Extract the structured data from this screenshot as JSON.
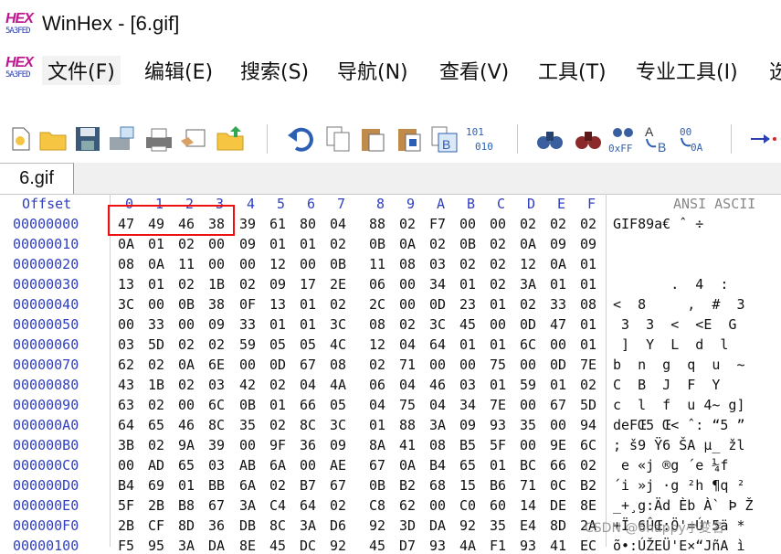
{
  "window": {
    "title": "WinHex - [6.gif]",
    "logo_text": "HEX",
    "logo_sub": "5A3FED"
  },
  "menu": [
    "文件(F)",
    "编辑(E)",
    "搜索(S)",
    "导航(N)",
    "查看(V)",
    "工具(T)",
    "专业工具(I)",
    "选"
  ],
  "toolbar_icons": [
    "new-file-icon",
    "open-folder-icon",
    "save-disk-icon",
    "save-all-icon",
    "print-icon",
    "properties-icon",
    "open-folder-up-icon",
    "undo-icon",
    "copy-icon",
    "paste-icon",
    "paste-write-icon",
    "copy-hex-icon",
    "convert-icon",
    "binoculars-icon",
    "find-text-icon",
    "find-hex-icon",
    "replace-text-icon",
    "replace-hex-icon",
    "goto-offset-icon"
  ],
  "toolbar_labels": {
    "hex_find": "0xFF",
    "convert_a": "101",
    "convert_b": "010",
    "rep_ab": "A",
    "rep_b": "B",
    "rep_hex_top": "00",
    "rep_hex_bot": "0A"
  },
  "tab": {
    "label": "6.gif"
  },
  "hex": {
    "offset_header": "Offset",
    "column_headers": [
      "0",
      "1",
      "2",
      "3",
      "4",
      "5",
      "6",
      "7",
      "8",
      "9",
      "A",
      "B",
      "C",
      "D",
      "E",
      "F"
    ],
    "ansi_header": "ANSI ASCII",
    "rows": [
      {
        "offset": "00000000",
        "bytes": [
          "47",
          "49",
          "46",
          "38",
          "39",
          "61",
          "80",
          "04",
          "88",
          "02",
          "F7",
          "00",
          "00",
          "02",
          "02",
          "02"
        ],
        "ansi": "GIF89a€ ˆ ÷"
      },
      {
        "offset": "00000010",
        "bytes": [
          "0A",
          "01",
          "02",
          "00",
          "09",
          "01",
          "01",
          "02",
          "0B",
          "0A",
          "02",
          "0B",
          "02",
          "0A",
          "09",
          "09"
        ],
        "ansi": ""
      },
      {
        "offset": "00000020",
        "bytes": [
          "08",
          "0A",
          "11",
          "00",
          "00",
          "12",
          "00",
          "0B",
          "11",
          "08",
          "03",
          "02",
          "02",
          "12",
          "0A",
          "01"
        ],
        "ansi": ""
      },
      {
        "offset": "00000030",
        "bytes": [
          "13",
          "01",
          "02",
          "1B",
          "02",
          "09",
          "17",
          "2E",
          "06",
          "00",
          "34",
          "01",
          "02",
          "3A",
          "01",
          "01"
        ],
        "ansi": "       .  4  :"
      },
      {
        "offset": "00000040",
        "bytes": [
          "3C",
          "00",
          "0B",
          "38",
          "0F",
          "13",
          "01",
          "02",
          "2C",
          "00",
          "0D",
          "23",
          "01",
          "02",
          "33",
          "08"
        ],
        "ansi": "<  8     ,  #  3"
      },
      {
        "offset": "00000050",
        "bytes": [
          "00",
          "33",
          "00",
          "09",
          "33",
          "01",
          "01",
          "3C",
          "08",
          "02",
          "3C",
          "45",
          "00",
          "0D",
          "47",
          "01"
        ],
        "ansi": " 3  3  <  <E  G"
      },
      {
        "offset": "00000060",
        "bytes": [
          "03",
          "5D",
          "02",
          "02",
          "59",
          "05",
          "05",
          "4C",
          "12",
          "04",
          "64",
          "01",
          "01",
          "6C",
          "00",
          "01"
        ],
        "ansi": " ]  Y  L  d  l"
      },
      {
        "offset": "00000070",
        "bytes": [
          "62",
          "02",
          "0A",
          "6E",
          "00",
          "0D",
          "67",
          "08",
          "02",
          "71",
          "00",
          "00",
          "75",
          "00",
          "0D",
          "7E"
        ],
        "ansi": "b  n  g  q  u  ~"
      },
      {
        "offset": "00000080",
        "bytes": [
          "43",
          "1B",
          "02",
          "03",
          "42",
          "02",
          "04",
          "4A",
          "06",
          "04",
          "46",
          "03",
          "01",
          "59",
          "01",
          "02"
        ],
        "ansi": "C  B  J  F  Y"
      },
      {
        "offset": "00000090",
        "bytes": [
          "63",
          "02",
          "00",
          "6C",
          "0B",
          "01",
          "66",
          "05",
          "04",
          "75",
          "04",
          "34",
          "7E",
          "00",
          "67",
          "5D"
        ],
        "ansi": "c  l  f  u 4~ g]"
      },
      {
        "offset": "000000A0",
        "bytes": [
          "64",
          "65",
          "46",
          "8C",
          "35",
          "02",
          "8C",
          "3C",
          "01",
          "88",
          "3A",
          "09",
          "93",
          "35",
          "00",
          "94"
        ],
        "ansi": "deFŒ5 Œ< ˆ: “5 ”"
      },
      {
        "offset": "000000B0",
        "bytes": [
          "3B",
          "02",
          "9A",
          "39",
          "00",
          "9F",
          "36",
          "09",
          "8A",
          "41",
          "08",
          "B5",
          "5F",
          "00",
          "9E",
          "6C"
        ],
        "ansi": "; š9 Ÿ6 ŠA µ_ žl"
      },
      {
        "offset": "000000C0",
        "bytes": [
          "00",
          "AD",
          "65",
          "03",
          "AB",
          "6A",
          "00",
          "AE",
          "67",
          "0A",
          "B4",
          "65",
          "01",
          "BC",
          "66",
          "02"
        ],
        "ansi": " ­e «j ®g ´e ¼f"
      },
      {
        "offset": "000000D0",
        "bytes": [
          "B4",
          "69",
          "01",
          "BB",
          "6A",
          "02",
          "B7",
          "67",
          "0B",
          "B2",
          "68",
          "15",
          "B6",
          "71",
          "0C",
          "B2"
        ],
        "ansi": "´i »j ·g ²h ¶q ²"
      },
      {
        "offset": "000000E0",
        "bytes": [
          "5F",
          "2B",
          "B8",
          "67",
          "3A",
          "C4",
          "64",
          "02",
          "C8",
          "62",
          "00",
          "C0",
          "60",
          "14",
          "DE",
          "8E"
        ],
        "ansi": "_+¸g:Äd Èb À` Þ Ž"
      },
      {
        "offset": "000000F0",
        "bytes": [
          "2B",
          "CF",
          "8D",
          "36",
          "DB",
          "8C",
          "3A",
          "D6",
          "92",
          "3D",
          "DA",
          "92",
          "35",
          "E4",
          "8D",
          "2A"
        ],
        "ansi": "+Ï 6ÛŒ:Ö'=Ú'5ä *"
      },
      {
        "offset": "00000100",
        "bytes": [
          "F5",
          "95",
          "3A",
          "DA",
          "8E",
          "45",
          "DC",
          "92",
          "45",
          "D7",
          "93",
          "4A",
          "F1",
          "93",
          "41",
          "EC"
        ],
        "ansi": "õ•:ÚŽEÜ'E×“JñA ì"
      }
    ]
  },
  "watermark": "CSDN @6happy小变名"
}
